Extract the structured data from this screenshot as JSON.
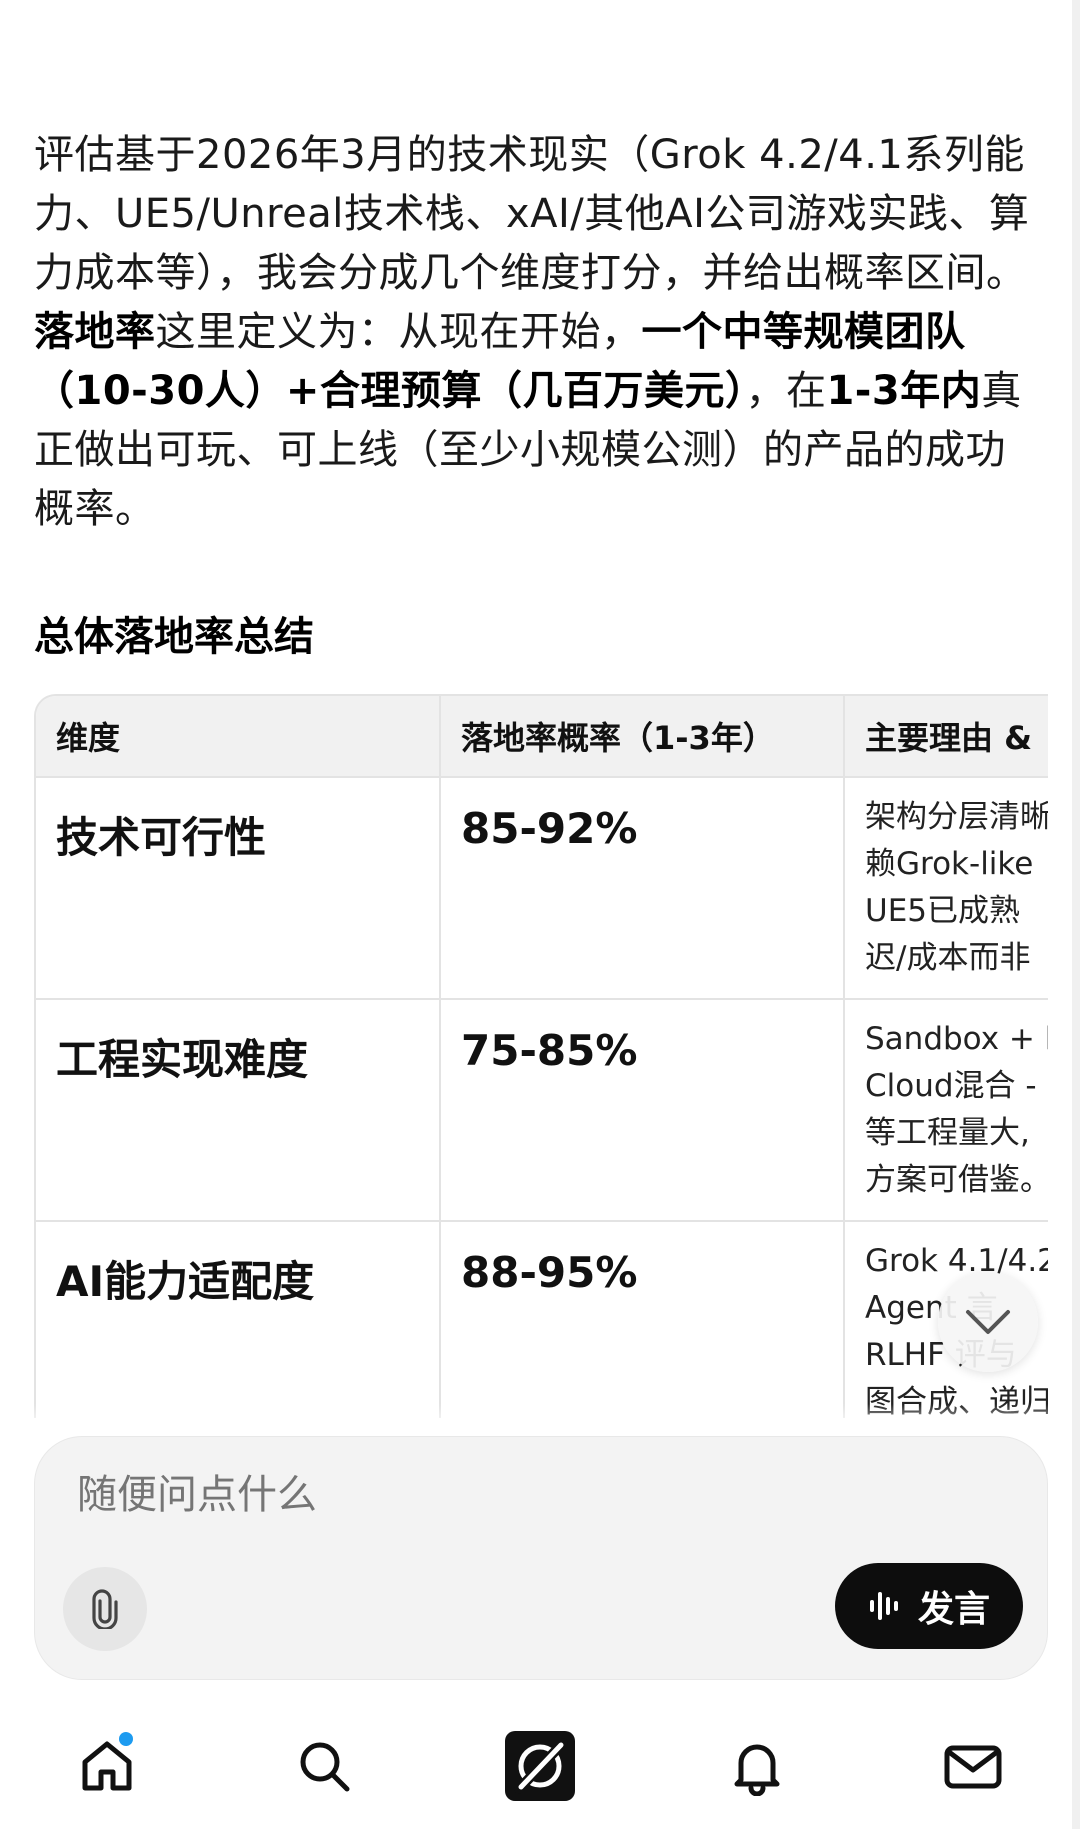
{
  "intro": {
    "p1": "评估基于2026年3月的技术现实（Grok 4.2/4.1系列能力、UE5/Unreal技术栈、xAI/其他AI公司游戏实践、算力成本等），我会分成几个维度打分，并给出概率区间。",
    "b1": "落地率",
    "p2": "这里定义为：从现在开始，",
    "b2": "一个中等规模团队（10-30人）+合理预算（几百万美元）",
    "p3": "，在",
    "b3": "1-3年内",
    "p4": "真正做出可玩、可上线（至少小规模公测）的产品的成功概率。"
  },
  "section_title": "总体落地率总结",
  "table": {
    "headers": [
      "维度",
      "落地率概率（1-3年）",
      "主要理由 &"
    ],
    "rows": [
      {
        "dimension": "技术可行性",
        "probability": "85-92%",
        "reason_lines": [
          "架构分层清晰",
          "赖Grok-like",
          "UE5已成熟",
          "迟/成本而非"
        ]
      },
      {
        "dimension": "工程实现难度",
        "probability": "75-85%",
        "reason_lines": [
          "Sandbox + l",
          "Cloud混合 -",
          "等工程量大,",
          "方案可借鉴。"
        ]
      },
      {
        "dimension": "AI能力适配度",
        "probability": "88-95%",
        "reason_lines": [
          "Grok 4.1/4.2",
          "Agent 言",
          "RLHF 评与",
          "图合成、递归"
        ]
      }
    ]
  },
  "composer": {
    "placeholder": "随便问点什么",
    "speak_label": "发言"
  },
  "icons": {
    "scroll_down": "chevron-down-icon",
    "attach": "paperclip-icon",
    "voice": "waveform-icon",
    "nav": [
      "home-icon",
      "search-icon",
      "grok-icon",
      "bell-icon",
      "mail-icon"
    ]
  },
  "colors": {
    "accent_dot": "#1d9bf0",
    "speak_button": "#0d0d0d"
  }
}
